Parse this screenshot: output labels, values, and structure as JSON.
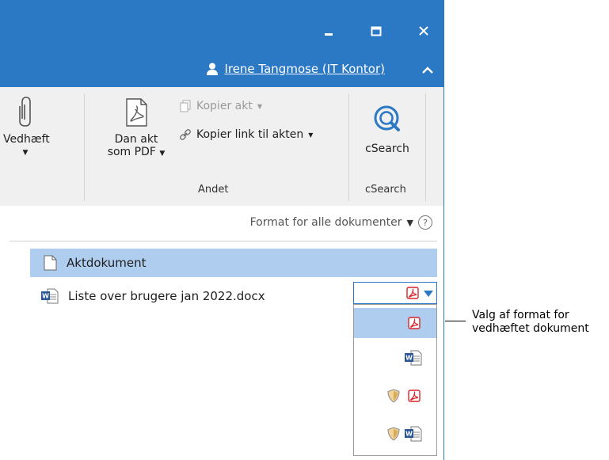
{
  "titlebar": {
    "user_name": "Irene Tangmose (IT Kontor)",
    "accent": "#2b78c5",
    "icons": [
      "minimize-icon",
      "maximize-icon",
      "close-icon",
      "user-icon",
      "chevron-up-icon"
    ]
  },
  "ribbon": {
    "attach_label": "Vedhæft",
    "pdf_label_line1": "Dan akt",
    "pdf_label_line2": "som PDF",
    "copy_act_label": "Kopier akt",
    "copy_link_label": "Kopier link til akten",
    "group_other_label": "Andet",
    "csearch_button_label": "cSearch",
    "csearch_group_label": "cSearch"
  },
  "format_bar": {
    "label": "Format for alle dokumenter",
    "help_symbol": "?"
  },
  "documents": {
    "main_doc": "Aktdokument",
    "attachment": "Liste over brugere jan 2022.docx"
  },
  "format_options": [
    "pdf",
    "word",
    "secured-pdf",
    "secured-word"
  ],
  "selected_format": "pdf",
  "callout": {
    "line1": "Valg af format for",
    "line2": "vedhæftet dokument"
  }
}
